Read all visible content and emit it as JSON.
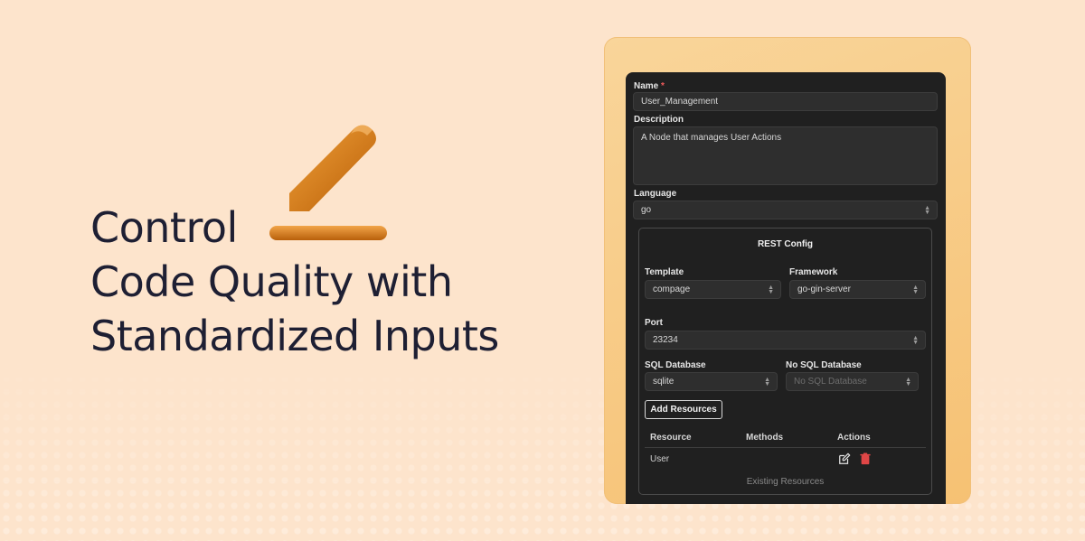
{
  "headline": {
    "line1": "Control",
    "line2": "Code Quality with",
    "line3": "Standardized Inputs"
  },
  "form": {
    "name_label": "Name",
    "name_required": "*",
    "name_value": "User_Management",
    "description_label": "Description",
    "description_value": "A Node that manages User Actions",
    "language_label": "Language",
    "language_value": "go"
  },
  "rest": {
    "title": "REST Config",
    "template_label": "Template",
    "template_value": "compage",
    "framework_label": "Framework",
    "framework_value": "go-gin-server",
    "port_label": "Port",
    "port_value": "23234",
    "sql_label": "SQL Database",
    "sql_value": "sqlite",
    "nosql_label": "No SQL Database",
    "nosql_placeholder": "No SQL Database",
    "add_resources_label": "Add Resources",
    "table": {
      "headers": [
        "Resource",
        "Methods",
        "Actions"
      ],
      "rows": [
        {
          "resource": "User",
          "methods": ""
        }
      ]
    },
    "caption": "Existing Resources"
  },
  "colors": {
    "accent": "#e58f1a",
    "panel": "#202020",
    "background": "#fde4cc",
    "delete": "#e04646"
  },
  "icons": [
    "pencil-icon",
    "edit-icon",
    "trash-icon",
    "select-chevron-icon",
    "number-stepper-icon"
  ]
}
